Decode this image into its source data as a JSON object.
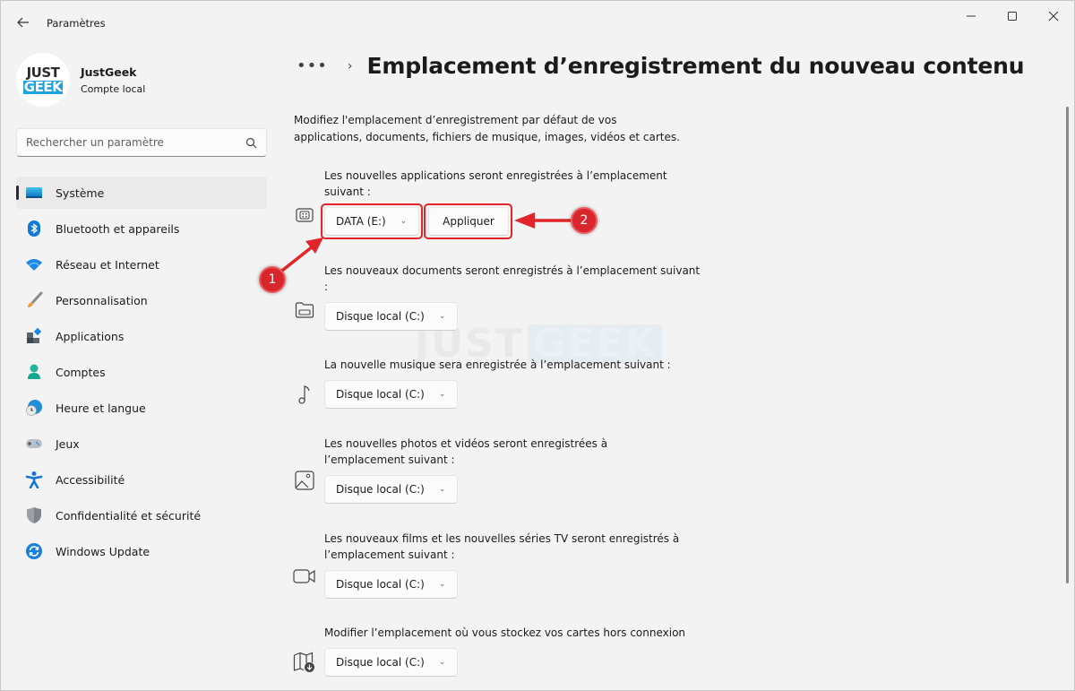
{
  "window": {
    "title": "Paramètres",
    "controls": {
      "minimize": "minimize-icon",
      "maximize": "maximize-icon",
      "close": "close-icon"
    }
  },
  "profile": {
    "avatar_line1": "JUST",
    "avatar_line2": "GEEK",
    "name": "JustGeek",
    "account_type": "Compte local"
  },
  "search": {
    "placeholder": "Rechercher un paramètre",
    "value": ""
  },
  "sidebar": {
    "items": [
      {
        "label": "Système",
        "icon": "monitor-icon",
        "selected": true
      },
      {
        "label": "Bluetooth et appareils",
        "icon": "bluetooth-icon"
      },
      {
        "label": "Réseau et Internet",
        "icon": "wifi-icon"
      },
      {
        "label": "Personnalisation",
        "icon": "paintbrush-icon"
      },
      {
        "label": "Applications",
        "icon": "apps-icon"
      },
      {
        "label": "Comptes",
        "icon": "person-icon"
      },
      {
        "label": "Heure et langue",
        "icon": "clock-globe-icon"
      },
      {
        "label": "Jeux",
        "icon": "gamepad-icon"
      },
      {
        "label": "Accessibilité",
        "icon": "accessibility-icon"
      },
      {
        "label": "Confidentialité et sécurité",
        "icon": "shield-icon"
      },
      {
        "label": "Windows Update",
        "icon": "update-icon"
      }
    ]
  },
  "breadcrumb": {
    "more": "•••",
    "separator": "›"
  },
  "page": {
    "title": "Emplacement d’enregistrement du nouveau contenu",
    "intro": "Modifiez l'emplacement d’enregistrement par défaut de vos applications, documents, fichiers de musique, images, vidéos et cartes."
  },
  "settings": [
    {
      "label": "Les nouvelles applications seront enregistrées à l’emplacement suivant :",
      "icon": "drive-apps-icon",
      "value": "DATA (E:)",
      "apply_label": "Appliquer"
    },
    {
      "label": "Les nouveaux documents seront enregistrés à l’emplacement suivant :",
      "icon": "folder-drive-icon",
      "value": "Disque local (C:)"
    },
    {
      "label": "La nouvelle musique sera enregistrée à l’emplacement suivant :",
      "icon": "music-note-icon",
      "value": "Disque local (C:)"
    },
    {
      "label": "Les nouvelles photos et vidéos seront enregistrées à l’emplacement suivant :",
      "icon": "image-icon",
      "value": "Disque local (C:)"
    },
    {
      "label": "Les nouveaux films et les nouvelles séries TV seront enregistrés à l’emplacement suivant :",
      "icon": "video-camera-icon",
      "value": "Disque local (C:)"
    },
    {
      "label": "Modifier l’emplacement où vous stockez vos cartes hors connexion",
      "icon": "map-download-icon",
      "value": "Disque local (C:)"
    }
  ],
  "annotations": {
    "badge1": "1",
    "badge2": "2",
    "color": "#e0252b"
  },
  "watermark": {
    "part1": "JUST",
    "part2": "GEEK"
  },
  "chevron_glyph": "⌄"
}
